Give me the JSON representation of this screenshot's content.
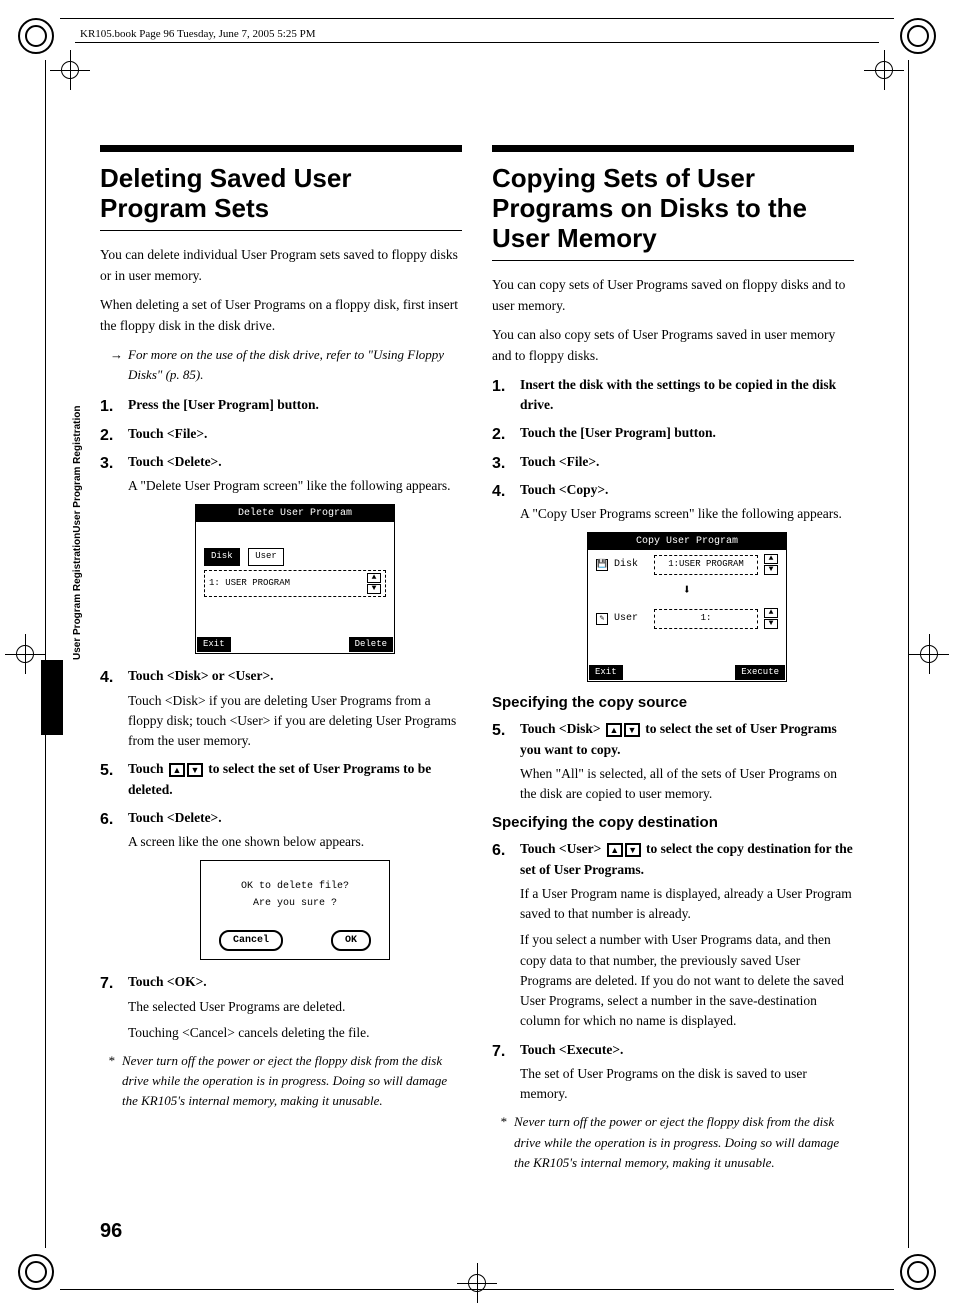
{
  "meta": {
    "header": "KR105.book  Page 96  Tuesday, June 7, 2005  5:25 PM",
    "page_number": "96",
    "side_text": "User Program RegistrationUser Program Registration"
  },
  "left": {
    "heading": "Deleting Saved User Program Sets",
    "intro1": "You can delete individual User Program sets saved to floppy disks or in user memory.",
    "intro2": "When deleting a set of User Programs on a floppy disk, first insert the floppy disk in the disk drive.",
    "ref": "For more on the use of the disk drive, refer to \"Using Floppy Disks\" (p. 85).",
    "s1": "Press the [User Program] button.",
    "s2": "Touch <File>.",
    "s3": "Touch <Delete>.",
    "s3b": "A \"Delete User Program screen\" like the following appears.",
    "lcd1": {
      "title": "Delete User Program",
      "tab_disk": "Disk",
      "tab_user": "User",
      "field": "1: USER PROGRAM",
      "btn_exit": "Exit",
      "btn_delete": "Delete"
    },
    "s4": "Touch <Disk> or <User>.",
    "s4b": "Touch <Disk> if you are deleting User Programs from a floppy disk; touch <User> if you are deleting User Programs from the user memory.",
    "s5a": "Touch ",
    "s5b": " to select the set of User Programs to be deleted.",
    "s6": "Touch <Delete>.",
    "s6b": "A screen like the one shown below appears.",
    "lcd2": {
      "line1": "OK to delete file?",
      "line2": "Are you sure ?",
      "cancel": "Cancel",
      "ok": "OK"
    },
    "s7": "Touch <OK>.",
    "s7b": "The selected User Programs are deleted.",
    "s7c": "Touching <Cancel> cancels deleting the file.",
    "note": "Never turn off the power or eject the floppy disk from the disk drive while the operation is in progress. Doing so will damage the KR105's internal memory, making it unusable."
  },
  "right": {
    "heading": "Copying Sets of User Programs on Disks to the User Memory",
    "intro1": "You can copy sets of User Programs saved on floppy disks and to user memory.",
    "intro2": "You can also copy sets of User Programs saved in user memory and to floppy disks.",
    "s1": "Insert the disk with the settings to be copied in the disk drive.",
    "s2": "Touch the [User Program] button.",
    "s3": "Touch <File>.",
    "s4": "Touch <Copy>.",
    "s4b": "A \"Copy User Programs screen\" like the following appears.",
    "lcd": {
      "title": "Copy User Program",
      "row1_label": "Disk",
      "row1_val": "1:USER PROGRAM",
      "row2_label": "User",
      "row2_val": "1:",
      "btn_exit": "Exit",
      "btn_exec": "Execute"
    },
    "sub1": "Specifying the copy source",
    "s5a": "Touch <Disk> ",
    "s5b": " to select the set of User Programs you want to copy.",
    "s5c": "When \"All\" is selected, all of the sets of User Programs on the disk are copied to user memory.",
    "sub2": "Specifying the copy destination",
    "s6a": "Touch <User> ",
    "s6b": " to select the copy destination for the set of User Programs.",
    "s6c": "If a User Program name is displayed, already a User Program saved to that number is already.",
    "s6d": "If you select a number with User Programs data, and then copy data to that number, the previously saved User Programs are deleted. If you do not want to delete the saved User Programs, select a number in the save-destination column for which no name is displayed.",
    "s7": "Touch <Execute>.",
    "s7b": "The set of User Programs on the disk is saved to user memory.",
    "note": "Never turn off the power or eject the floppy disk from the disk drive while the operation is in progress. Doing so will damage the KR105's internal memory, making it unusable."
  }
}
